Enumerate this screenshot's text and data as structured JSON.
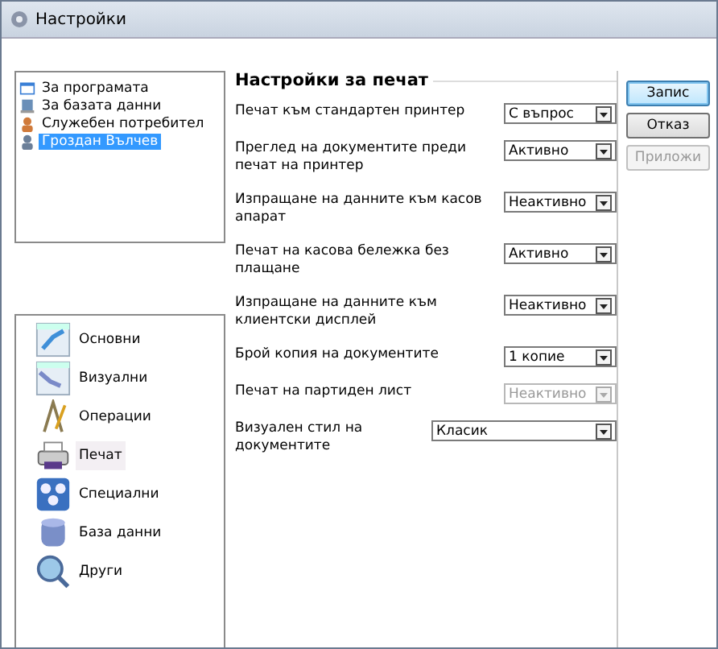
{
  "window": {
    "title": "Настройки"
  },
  "user_list": [
    {
      "label": "За програмата",
      "kind": "info",
      "selected": false
    },
    {
      "label": "За базата данни",
      "kind": "database",
      "selected": false
    },
    {
      "label": "Служебен потребител",
      "kind": "user",
      "selected": false
    },
    {
      "label": "Гроздан Вълчев",
      "kind": "user-gray",
      "selected": true
    }
  ],
  "categories": [
    {
      "label": "Основни",
      "kind": "basic",
      "selected": false
    },
    {
      "label": "Визуални",
      "kind": "visual",
      "selected": false
    },
    {
      "label": "Операции",
      "kind": "operations",
      "selected": false
    },
    {
      "label": "Печат",
      "kind": "print",
      "selected": true
    },
    {
      "label": "Специални",
      "kind": "special",
      "selected": false
    },
    {
      "label": "База данни",
      "kind": "database",
      "selected": false
    },
    {
      "label": "Други",
      "kind": "other",
      "selected": false
    }
  ],
  "panel": {
    "title": "Настройки за печат",
    "settings": [
      {
        "label": "Печат към стандартен принтер",
        "value": "С въпрос",
        "kind": "narrow",
        "disabled": false
      },
      {
        "label": "Преглед на документите преди печат на принтер",
        "value": "Активно",
        "kind": "narrow",
        "disabled": false
      },
      {
        "label": "Изпращане на данните към касов апарат",
        "value": "Неактивно",
        "kind": "narrow",
        "disabled": false
      },
      {
        "label": "Печат на касова бележка без плащане",
        "value": "Активно",
        "kind": "narrow",
        "disabled": false
      },
      {
        "label": "Изпращане на данните към клиентски дисплей",
        "value": "Неактивно",
        "kind": "narrow",
        "disabled": false
      },
      {
        "label": "Брой копия на документите",
        "value": "1 копие",
        "kind": "narrow",
        "disabled": false
      },
      {
        "label": "Печат на партиден лист",
        "value": "Неактивно",
        "kind": "narrow",
        "disabled": true
      },
      {
        "label": "Визуален стил на документите",
        "value": "Класик",
        "kind": "wide",
        "disabled": false
      }
    ]
  },
  "buttons": [
    {
      "label": "Запис",
      "disabled": false,
      "selected": true
    },
    {
      "label": "Отказ",
      "disabled": false,
      "selected": false
    },
    {
      "label": "Приложи",
      "disabled": true,
      "selected": false
    }
  ]
}
